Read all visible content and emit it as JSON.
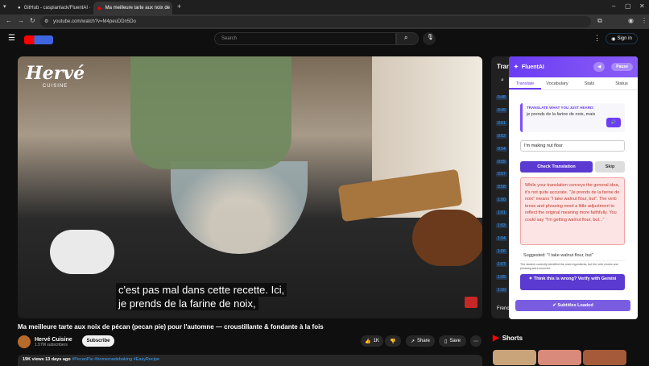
{
  "browser": {
    "tabs": [
      {
        "label": "GitHub - caspianlack/FluentAI · ",
        "active": false
      },
      {
        "label": "Ma meilleure tarte aux noix de",
        "active": true
      }
    ],
    "url": "youtube.com/watch?v=M4peuDDn5Do"
  },
  "youtube": {
    "search_placeholder": "Search",
    "sign_in": "Sign in",
    "video": {
      "brand_overlay": "Hervé",
      "brand_sub": "CUISINE",
      "caption_line1": "c'est pas mal dans cette recette. Ici,",
      "caption_line2": "je prends de la farine de noix,",
      "title": "Ma meilleure tarte aux noix de pécan (pecan pie) pour l'automne — croustillante & fondante à la fois",
      "channel": "Hervé Cuisine",
      "subscribers": "1.57M subscribers",
      "subscribe": "Subscribe",
      "likes": "1K",
      "share": "Share",
      "save": "Save",
      "views_date": "19K views  13 days ago",
      "hashtags": "#PecanPie #homemadebaking #EasyRecipe"
    },
    "transcript": {
      "header": "Tran",
      "times": [
        "0:48",
        "0:49",
        "0:51",
        "0:52",
        "0:54",
        "0:55",
        "0:57",
        "0:58",
        "1:00",
        "1:01",
        "1:03",
        "1:04",
        "1:06",
        "1:07",
        "1:09",
        "1:10"
      ],
      "footer": "Frenc"
    },
    "shorts_label": "Shorts"
  },
  "fluent": {
    "title": "FluentAI",
    "pause": "Pause",
    "tabs": [
      "Translate",
      "Vocabulary",
      "Stats",
      "Status"
    ],
    "prompt_label": "TRANSLATE WHAT YOU JUST HEARD:",
    "prompt_text": "je prends de la farine de noix, mais",
    "answer": "I'm making nut flour",
    "check": "Check Translation",
    "skip": "Skip",
    "feedback": "While your translation conveys the general idea, it's not quite accurate. \"Je prends de la farine de noix\" means \"I take walnut flour, but\". The verb tense and phrasing need a little adjustment to reflect the original meaning more faithfully. You could say \"I'm getting walnut flour, but...\"",
    "suggested": "Suggested: \"I take walnut flour, but\"",
    "note": "The student correctly identified the main ingredients, but the verb choice and phrasing were incorrect.",
    "verify": "Think this is wrong? Verify with Gemini",
    "subtitles_loaded": "Subtitles Loaded"
  }
}
